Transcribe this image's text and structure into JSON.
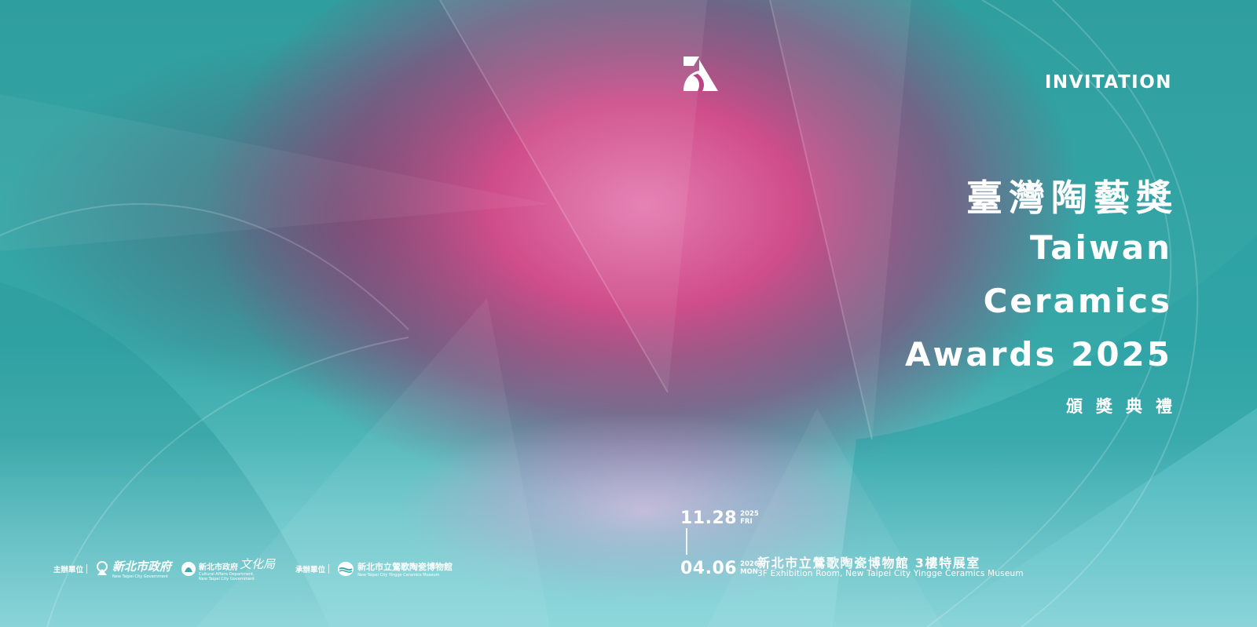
{
  "invitation": "INVITATION",
  "title_zh": "臺灣陶藝獎",
  "title_en": [
    "Taiwan",
    "Ceramics",
    "Awards 2025"
  ],
  "subtitle_zh": "頒獎典禮",
  "date_start": {
    "day": "11.28",
    "year": "2025",
    "weekday": "FRI"
  },
  "date_end": {
    "day": "04.06",
    "year": "2026",
    "weekday": "MON"
  },
  "venue_zh": "新北市立鶯歌陶瓷博物館 3樓特展室",
  "venue_en": "3F Exhibition Room, New Taipei City Yingge Ceramics Museum",
  "organizers": {
    "host_label": "主辦單位",
    "host_1_name": "新北市政府",
    "host_1_en": "New Taipei City Government",
    "host_2_name": "新北市政府",
    "host_2_script": "文化局",
    "host_2_en_1": "Cultural Affairs Department,",
    "host_2_en_2": "New Taipei City Government",
    "co_label": "承辦單位",
    "co_name": "新北市立鶯歌陶瓷博物館",
    "co_en": "New Taipei City Yingge Ceramics Museum"
  },
  "colors": {
    "teal": "#3fb3b3",
    "magenta": "#c8447f",
    "pink": "#e07aa8",
    "coral": "#e8706a",
    "text": "#ffffff"
  },
  "icons": [
    "brand-logo-icon",
    "host-1-emblem-icon",
    "host-2-emblem-icon",
    "co-organizer-emblem-icon"
  ]
}
